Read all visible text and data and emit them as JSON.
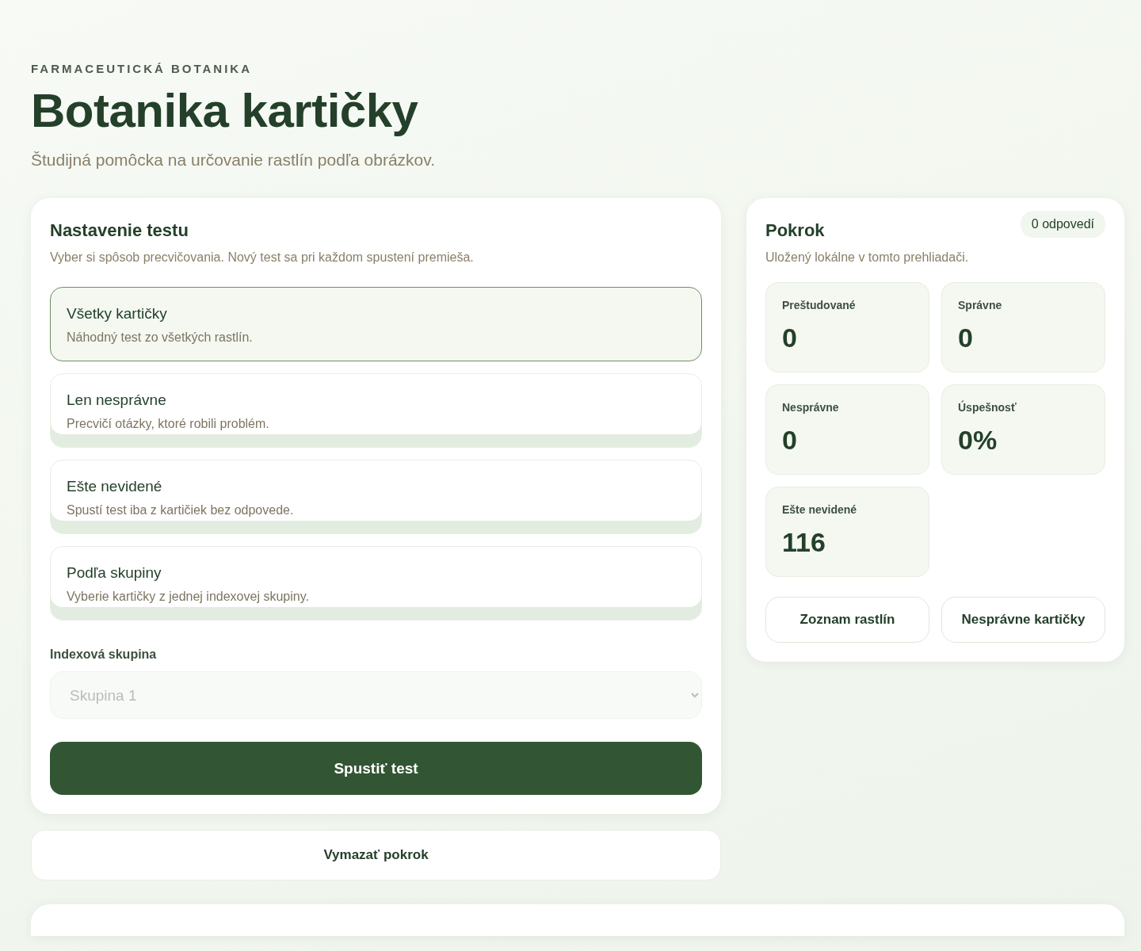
{
  "header": {
    "eyebrow": "FARMACEUTICKÁ BOTANIKA",
    "title": "Botanika kartičky",
    "subtitle": "Študijná pomôcka na určovanie rastlín podľa obrázkov."
  },
  "setup": {
    "title": "Nastavenie testu",
    "description": "Vyber si spôsob precvičovania. Nový test sa pri každom spustení premieša.",
    "modes": [
      {
        "title": "Všetky kartičky",
        "description": "Náhodný test zo všetkých rastlín.",
        "selected": true
      },
      {
        "title": "Len nesprávne",
        "description": "Precvičí otázky, ktoré robili problém.",
        "selected": false
      },
      {
        "title": "Ešte nevidené",
        "description": "Spustí test iba z kartičiek bez odpovede.",
        "selected": false
      },
      {
        "title": "Podľa skupiny",
        "description": "Vyberie kartičky z jednej indexovej skupiny.",
        "selected": false
      }
    ],
    "group_label": "Indexová skupina",
    "group_select": {
      "value": "Skupina 1",
      "disabled": true
    },
    "start_button": "Spustiť test"
  },
  "reset_button": "Vymazať pokrok",
  "progress": {
    "title": "Pokrok",
    "description": "Uložený lokálne v tomto prehliadači.",
    "badge": "0 odpovedí",
    "stats": [
      {
        "label": "Preštudované",
        "value": "0"
      },
      {
        "label": "Správne",
        "value": "0"
      },
      {
        "label": "Nesprávne",
        "value": "0"
      },
      {
        "label": "Úspešnosť",
        "value": "0%"
      },
      {
        "label": "Ešte nevidené",
        "value": "116"
      }
    ],
    "buttons": [
      "Zoznam rastlín",
      "Nesprávne kartičky"
    ]
  }
}
